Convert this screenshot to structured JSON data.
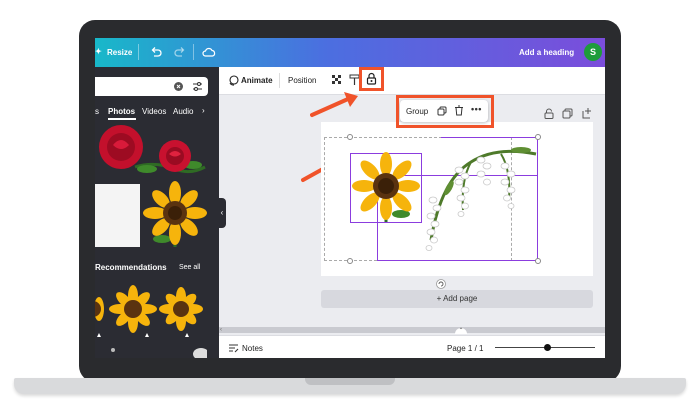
{
  "topbar": {
    "resize_label": "Resize",
    "heading_label": "Add a heading",
    "avatar_initial": "S"
  },
  "panel": {
    "tabs": [
      "s",
      "Photos",
      "Videos",
      "Audio"
    ],
    "recommendations_label": "Recommendations",
    "see_all_label": "See all"
  },
  "toolbar": {
    "animate_label": "Animate",
    "position_label": "Position"
  },
  "floating_toolbar": {
    "group_label": "Group"
  },
  "canvas": {
    "add_page_label": "+ Add page"
  },
  "bottombar": {
    "notes_label": "Notes",
    "page_indicator": "Page 1 / 1"
  },
  "colors": {
    "accent_red": "#f0532a",
    "selection_purple": "#8b3dde",
    "avatar_green": "#1e9c3b"
  }
}
